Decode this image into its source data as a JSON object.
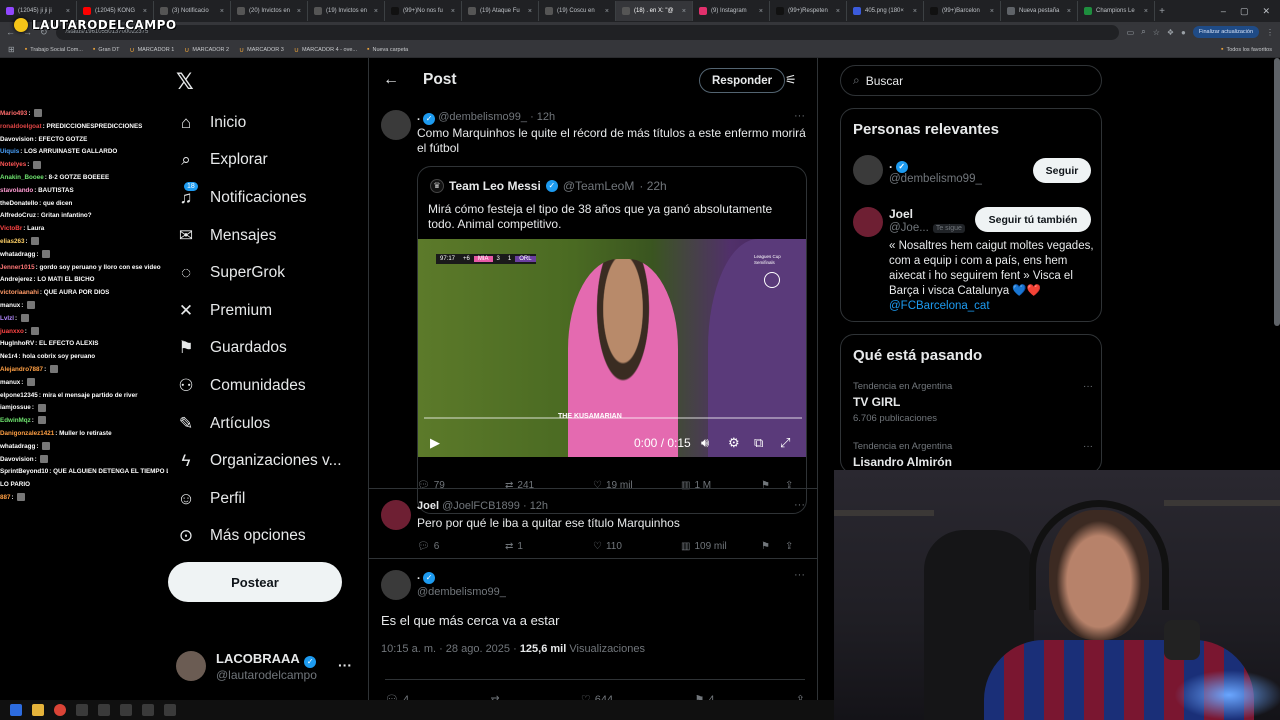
{
  "browser": {
    "tabs": [
      {
        "label": "(12045) ji ji ji",
        "icon_color": "#9147ff"
      },
      {
        "label": "(12045) KONG",
        "icon_color": "#ff0000"
      },
      {
        "label": "(3) Notificacio",
        "icon_color": "#555555"
      },
      {
        "label": "(20) Invictos en",
        "icon_color": "#555555"
      },
      {
        "label": "(19) Invictos en",
        "icon_color": "#555555"
      },
      {
        "label": "(99+)No nos fu",
        "icon_color": "#111111"
      },
      {
        "label": "(19) Ataque Fu",
        "icon_color": "#555555"
      },
      {
        "label": "(19) Coscu en",
        "icon_color": "#555555"
      },
      {
        "label": "(18) . en X: \"@",
        "icon_color": "#555555",
        "active": true
      },
      {
        "label": "(9) Instagram",
        "icon_color": "#e1306c"
      },
      {
        "label": "(99+)Respeten",
        "icon_color": "#111111"
      },
      {
        "label": "405.png (180×",
        "icon_color": "#3b5bdb"
      },
      {
        "label": "(99+)Barcelon",
        "icon_color": "#111111"
      },
      {
        "label": "Nueva pestaña",
        "icon_color": "#5f6368"
      },
      {
        "label": "Champions Le",
        "icon_color": "#1e8e3e"
      }
    ],
    "url": "/status/1961055013700022375",
    "update_button": "Finalizar actualización",
    "bookmarks": [
      "Trabajo Social Com...",
      "Gran DT",
      "MARCADOR 1",
      "MARCADOR 2",
      "MARCADOR 3",
      "MARCADOR 4 - ove...",
      "Nueva carpeta"
    ],
    "all_bookmarks": "Todos los favoritos"
  },
  "stream_logo": "LAUTARODELCAMPO",
  "chat": [
    {
      "user": "Mario493",
      "msg": "",
      "color": "#ff6b6b",
      "emote": true
    },
    {
      "user": "ronaldoelgoat",
      "msg": "PREDICCIONESPREDICCIONES",
      "color": "#d44"
    },
    {
      "user": "Davovision",
      "msg": "EFECTO GOTZE",
      "color": "#ffffff"
    },
    {
      "user": "Uiquis",
      "msg": "LOS ARRUINASTE GALLARDO",
      "color": "#4aa3ff"
    },
    {
      "user": "Notelyes",
      "msg": "",
      "color": "#ff5555",
      "emote": true
    },
    {
      "user": "Anakin_Booee",
      "msg": "8-2 GOTZE BOEEEE",
      "color": "#6ee36e"
    },
    {
      "user": "stavolando",
      "msg": "BAUTISTAS",
      "color": "#ff9bd2"
    },
    {
      "user": "theDonatello",
      "msg": "que dicen",
      "color": "#ffffff"
    },
    {
      "user": "AlfredoCruz",
      "msg": "Gritan infantino?",
      "color": "#ffffff"
    },
    {
      "user": "VictoBr",
      "msg": "Laura",
      "color": "#ff4444"
    },
    {
      "user": "elias263",
      "msg": "",
      "color": "#ffd166",
      "emote": true
    },
    {
      "user": "whatadragg",
      "msg": "",
      "color": "#ffffff",
      "emote": true
    },
    {
      "user": "Jenner1015",
      "msg": "gordo soy peruano y lloro con ese video",
      "color": "#ff7777"
    },
    {
      "user": "Andrejerez",
      "msg": "LO MATI EL BICHO",
      "color": "#ffffff"
    },
    {
      "user": "victoriaanahi",
      "msg": "QUE AURA POR DIOS",
      "color": "#ff9966"
    },
    {
      "user": "manux",
      "msg": "",
      "color": "#ffffff",
      "emote": true
    },
    {
      "user": "Lvlzl",
      "msg": "",
      "color": "#b388ff",
      "emote": true
    },
    {
      "user": "juanxxo",
      "msg": "",
      "color": "#ff4444",
      "emote": true
    },
    {
      "user": "HuglnhoRV",
      "msg": "EL EFECTO ALEXIS",
      "color": "#ffffff"
    },
    {
      "user": "Ne1r4",
      "msg": "hola cobrix soy peruano",
      "color": "#ffffff"
    },
    {
      "user": "Alejandro7887",
      "msg": "",
      "color": "#ff9f43",
      "emote": true
    },
    {
      "user": "manux",
      "msg": "",
      "color": "#ffffff",
      "emote": true
    },
    {
      "user": "elpone12345",
      "msg": "mira el mensaje partido de river",
      "color": "#ffffff"
    },
    {
      "user": "iamjossue",
      "msg": "",
      "color": "#ffffff",
      "emote": true
    },
    {
      "user": "EdwinMqz",
      "msg": "",
      "color": "#6ee36e",
      "emote": true
    },
    {
      "user": "Danigonzalez1421",
      "msg": "Muller lo retiraste",
      "color": "#ff9f43"
    },
    {
      "user": "whatadragg",
      "msg": "",
      "color": "#ffffff",
      "emote": true
    },
    {
      "user": "Davovision",
      "msg": "",
      "color": "#ffffff",
      "emote": true
    },
    {
      "user": "SprintBeyond10",
      "msg": "QUE ALGUIEN DETENGA EL TIEMPO LA P... QUE",
      "color": "#ffffff"
    },
    {
      "user": "",
      "msg": "LO PARIO",
      "color": "#ffffff"
    },
    {
      "user": "887",
      "msg": "",
      "color": "#ff9f43",
      "emote": true
    }
  ],
  "nav": {
    "items": [
      {
        "label": "Inicio",
        "icon": "home-icon",
        "glyph": "⌂"
      },
      {
        "label": "Explorar",
        "icon": "search-icon",
        "glyph": "⌕"
      },
      {
        "label": "Notificaciones",
        "icon": "bell-icon",
        "glyph": "♫",
        "badge": "18"
      },
      {
        "label": "Mensajes",
        "icon": "mail-icon",
        "glyph": "✉"
      },
      {
        "label": "SuperGrok",
        "icon": "grok-icon",
        "glyph": "◌"
      },
      {
        "label": "Premium",
        "icon": "x-logo-icon",
        "glyph": "✕"
      },
      {
        "label": "Guardados",
        "icon": "bookmark-icon",
        "glyph": "⚑"
      },
      {
        "label": "Comunidades",
        "icon": "communities-icon",
        "glyph": "⚇"
      },
      {
        "label": "Artículos",
        "icon": "article-icon",
        "glyph": "✎"
      },
      {
        "label": "Organizaciones v...",
        "icon": "lightning-icon",
        "glyph": "ϟ"
      },
      {
        "label": "Perfil",
        "icon": "profile-icon",
        "glyph": "☺"
      },
      {
        "label": "Más opciones",
        "icon": "more-circle-icon",
        "glyph": "⊙"
      }
    ],
    "post_button": "Postear",
    "account": {
      "name": "LACOBRAAA",
      "handle": "@lautarodelcampo"
    }
  },
  "main": {
    "title": "Post",
    "reply_button": "Responder",
    "tweet1": {
      "name": ".",
      "handle": "@dembelismo99_",
      "time": "· 12h",
      "text": "Como Marquinhos le quite el récord de más títulos a este enfermo morirá el fútbol",
      "quote": {
        "name": "Team Leo Messi",
        "handle": "@TeamLeoM",
        "time": "· 22h",
        "text": "Mirá cómo festeja el tipo de 38 años que ya ganó absolutamente todo. Animal competitivo.",
        "video": {
          "score": [
            "97:17",
            "+6",
            "MIA",
            "3",
            "1",
            "ORL"
          ],
          "competition": "Leagues Cup Semifinals",
          "watermark": "THE KUSAMARIAN",
          "time": "0:00 / 0:15",
          "progress": 0
        }
      },
      "stats": {
        "replies": "79",
        "reposts": "241",
        "likes": "19 mil",
        "views": "1 M"
      }
    },
    "tweet2": {
      "name": "Joel",
      "handle": "@JoelFCB1899",
      "time": "· 12h",
      "text": "Pero por qué le iba a quitar ese título Marquinhos",
      "stats": {
        "replies": "6",
        "reposts": "1",
        "likes": "110",
        "views": "109 mil"
      }
    },
    "tweet3": {
      "name": ".",
      "handle": "@dembelismo99_",
      "text": "Es el que más cerca va a estar",
      "timestamp": "10:15 a. m. · 28 ago. 2025 · ",
      "views": "125,6 mil",
      "views_label": "Visualizaciones",
      "stats": {
        "replies": "4",
        "likes": "644",
        "bookmarks": "4"
      }
    }
  },
  "right": {
    "search_placeholder": "Buscar",
    "relevant_title": "Personas relevantes",
    "people": [
      {
        "name": ".",
        "handle": "@dembelismo99_",
        "button": "Seguir"
      },
      {
        "name": "Joel",
        "handle": "@Joe...",
        "tag": "Te sigue",
        "button": "Seguir tú también",
        "bio": "« Nosaltres hem caigut moltes vegades, com a equip i com a país, ens hem aixecat i ho seguirem fent » Visca el Barça i visca Catalunya 💙❤️",
        "bio_link": "@FCBarcelona_cat"
      }
    ],
    "trending_title": "Qué está pasando",
    "trends": [
      {
        "meta": "Tendencia en Argentina",
        "topic": "TV GIRL",
        "count": "6.706 publicaciones"
      },
      {
        "meta": "Tendencia en Argentina",
        "topic": "Lisandro Almirón",
        "count": ""
      }
    ]
  },
  "colors": {
    "accent": "#1d9bf0",
    "bg": "#000000",
    "border": "#2f3336",
    "muted": "#71767b"
  }
}
